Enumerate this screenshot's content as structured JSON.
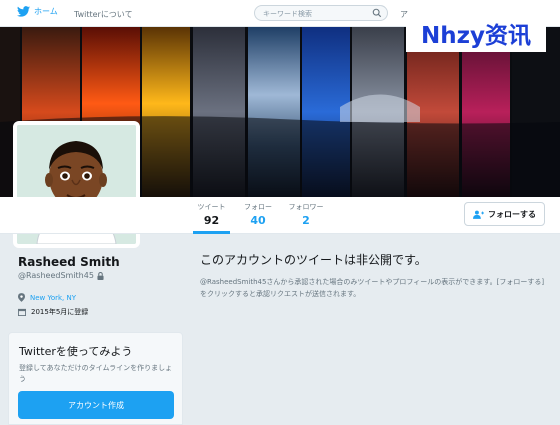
{
  "nav": {
    "home_label": "ホーム",
    "about_label": "Twitterについて",
    "search_placeholder": "キーワード検索",
    "extra_label": "ア"
  },
  "watermark": "Nhzy资讯",
  "stats": [
    {
      "label": "ツイート",
      "value": "92"
    },
    {
      "label": "フォロー",
      "value": "40"
    },
    {
      "label": "フォロワー",
      "value": "2"
    }
  ],
  "follow_button": "フォローする",
  "profile": {
    "name": "Rasheed Smith",
    "handle": "@RasheedSmith45",
    "location": "New York, NY",
    "joined": "2015年5月に登録"
  },
  "signup": {
    "title": "Twitterを使ってみよう",
    "desc": "登録してあなただけのタイムラインを作りましょう",
    "button": "アカウント作成"
  },
  "protected": {
    "title": "このアカウントのツイートは非公開です。",
    "body": "@RasheedSmith45さんから承認された場合のみツイートやプロフィールの表示ができます。[フォローする] をクリックすると承認リクエストが送信されます。"
  },
  "colors": {
    "accent": "#1da1f2",
    "background": "#e6ecf0",
    "watermark": "#1c3fd6"
  }
}
